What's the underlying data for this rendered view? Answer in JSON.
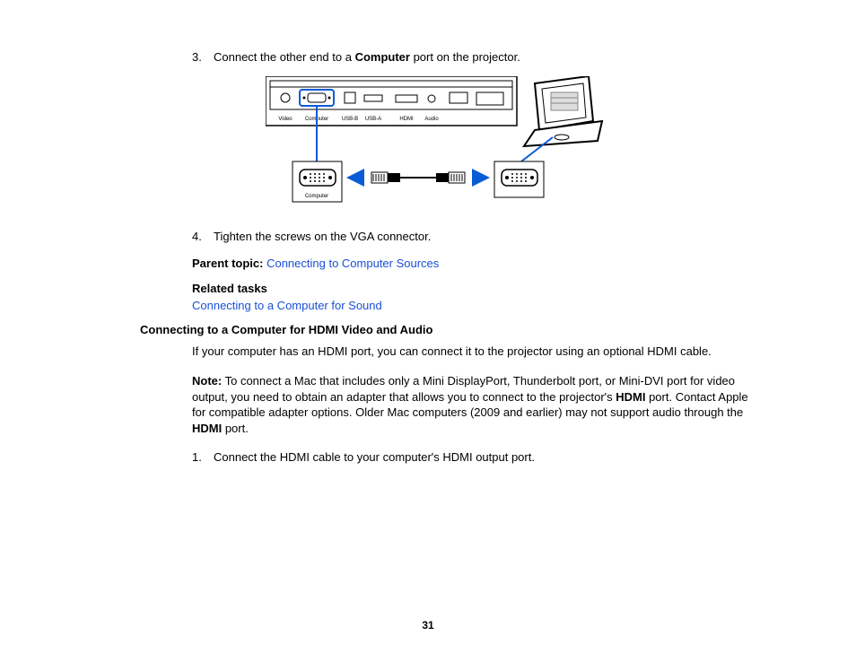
{
  "step3": {
    "num": "3.",
    "text_before": "Connect the other end to a ",
    "bold": "Computer",
    "text_after": " port on the projector."
  },
  "port_labels": {
    "video": "Video",
    "computer": "Computer",
    "usb_b": "USB-B",
    "usb_a": "USB-A",
    "hdmi": "HDMI",
    "audio": "Audio",
    "computer_box": "Computer"
  },
  "step4": {
    "num": "4.",
    "text": "Tighten the screws on the VGA connector."
  },
  "parent_topic": {
    "label": "Parent topic: ",
    "link": "Connecting to Computer Sources"
  },
  "related": {
    "label": "Related tasks",
    "link": "Connecting to a Computer for Sound"
  },
  "section_heading": "Connecting to a Computer for HDMI Video and Audio",
  "intro_para": "If your computer has an HDMI port, you can connect it to the projector using an optional HDMI cable.",
  "note": {
    "label": "Note:",
    "text_before": " To connect a Mac that includes only a Mini DisplayPort, Thunderbolt port, or Mini-DVI port for video output, you need to obtain an adapter that allows you to connect to the projector's ",
    "bold1": "HDMI",
    "text_mid": " port. Contact Apple for compatible adapter options. Older Mac computers (2009 and earlier) may not support audio through the ",
    "bold2": "HDMI",
    "text_after": " port."
  },
  "step1": {
    "num": "1.",
    "text": "Connect the HDMI cable to your computer's HDMI output port."
  },
  "page_number": "31"
}
